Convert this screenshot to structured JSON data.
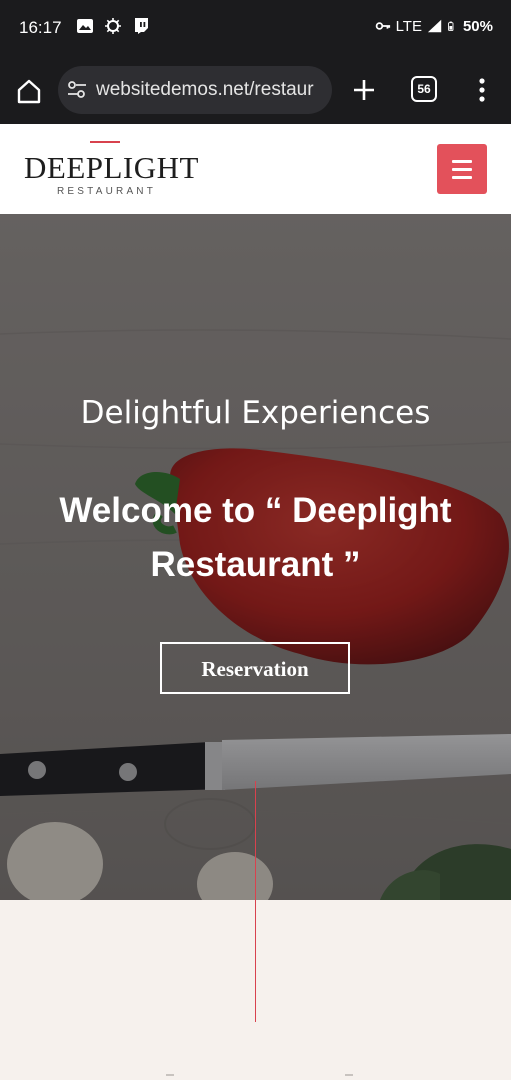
{
  "status_bar": {
    "time": "16:17",
    "network": "LTE",
    "battery": "50%",
    "icons_left": [
      "image-icon",
      "sync-icon",
      "twitch-icon"
    ],
    "icons_right": [
      "vpn-key-icon",
      "signal-icon",
      "battery-icon"
    ]
  },
  "browser": {
    "url": "websitedemos.net/restaur",
    "tab_count": "56"
  },
  "site": {
    "logo_title": "DEEPLIGHT",
    "logo_subtitle": "RESTAURANT"
  },
  "hero": {
    "subtitle": "Delightful Experiences",
    "title": "Welcome to “ Deeplight Restaurant ”",
    "button_label": "Reservation"
  },
  "colors": {
    "accent": "#e3515b",
    "status_bg": "#1b1b1d",
    "section_bg": "#f6f1ed"
  }
}
